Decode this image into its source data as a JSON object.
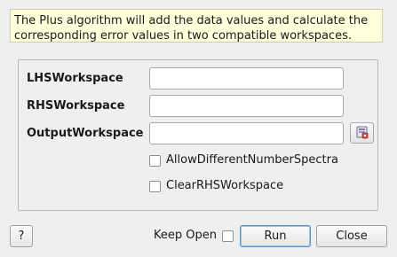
{
  "description": "The Plus algorithm will add the data values and calculate the corresponding error values in two compatible workspaces.",
  "properties": {
    "lhs": {
      "label": "LHSWorkspace",
      "value": ""
    },
    "rhs": {
      "label": "RHSWorkspace",
      "value": ""
    },
    "output": {
      "label": "OutputWorkspace",
      "value": ""
    }
  },
  "options": {
    "allow_different_spectra": {
      "label": "AllowDifferentNumberSpectra",
      "checked": false
    },
    "clear_rhs": {
      "label": "ClearRHSWorkspace",
      "checked": false
    }
  },
  "footer": {
    "help_label": "?",
    "keep_open_label": "Keep Open",
    "keep_open_checked": false,
    "run_label": "Run",
    "close_label": "Close"
  },
  "icons": {
    "browse": "workspace-browse-icon"
  }
}
